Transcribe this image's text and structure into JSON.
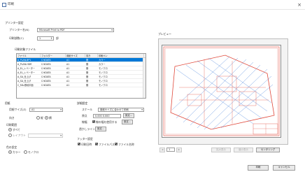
{
  "window": {
    "title": "印刷",
    "close_glyph": "×"
  },
  "printer": {
    "group_label": "プリンター設定",
    "name_label": "プリンター名(N)",
    "name_value": "Microsoft Print to PDF",
    "copies_label": "印刷部数(C)",
    "copies_value": "1",
    "copies_unit": "部"
  },
  "sheet_list": {
    "label": "印刷対象ファイル",
    "columns": [
      "ファイル",
      "フォルダー",
      "用紙サイズ",
      "向き",
      "印刷ペン"
    ],
    "rows": [
      [
        "A_PLAN-BP1",
        "C:¥DATA",
        "A1",
        "横",
        "カラー"
      ],
      [
        "A_PLAN-HDR",
        "C:¥DATA",
        "A1",
        "横",
        "カラー"
      ],
      [
        "A_EL_レベーター",
        "C:¥DATA",
        "A1",
        "横",
        "モノクロ"
      ],
      [
        "A_EL_レベーター",
        "C:¥DATA",
        "A1",
        "横",
        "モノクロ"
      ],
      [
        "A_SA_仕上げ",
        "C:¥DATA",
        "A1",
        "横",
        "モノクロ"
      ],
      [
        "A_SA_仕上げ",
        "C:¥DATA",
        "A1",
        "横",
        "モノクロ"
      ],
      [
        "C_MA-敷地平面",
        "C:¥DATA",
        "A1",
        "横",
        "モノクロ"
      ]
    ]
  },
  "paper": {
    "group_label": "用紙",
    "size_label": "用紙サイズ(Z)",
    "size_value": "A1",
    "orientation_label": "向き",
    "portrait": "縦",
    "landscape": "横",
    "range_label": "印刷範囲",
    "range_all": "すべて",
    "range_layout": "レイアウト",
    "color_label": "色の設定",
    "color_color": "カラー",
    "color_mono": "モノクロ"
  },
  "detail": {
    "group_label": "詳細設定",
    "scale_label": "スケール",
    "scale_value": "用紙サイズに合わせて印刷",
    "origin_label": "原点",
    "origin_value": "0.000 0.000",
    "origin_button": "設定...",
    "pen_label": "線幅",
    "pen_option": "線の幅を使用する",
    "pen_button": "設定...",
    "stamp_label": "透かしライン",
    "stamp_button": "設定..."
  },
  "footer_options": {
    "group_label": "フッター設定",
    "date": "印刷日時",
    "file": "ファイルパス",
    "name": "ファイル名称"
  },
  "preview": {
    "label": "プレビュー",
    "prev_glyph": "◀",
    "page_value": "1",
    "next_glyph": "▶",
    "zoom_in": "拡大表示",
    "zoom_out": "縮小表示",
    "fit": "センタリング"
  },
  "actions": {
    "print": "印刷",
    "cancel": "キャンセル"
  },
  "colors": {
    "accent": "#0078d7",
    "drawing_red": "#e0483a",
    "drawing_blue": "#3a78d8"
  }
}
